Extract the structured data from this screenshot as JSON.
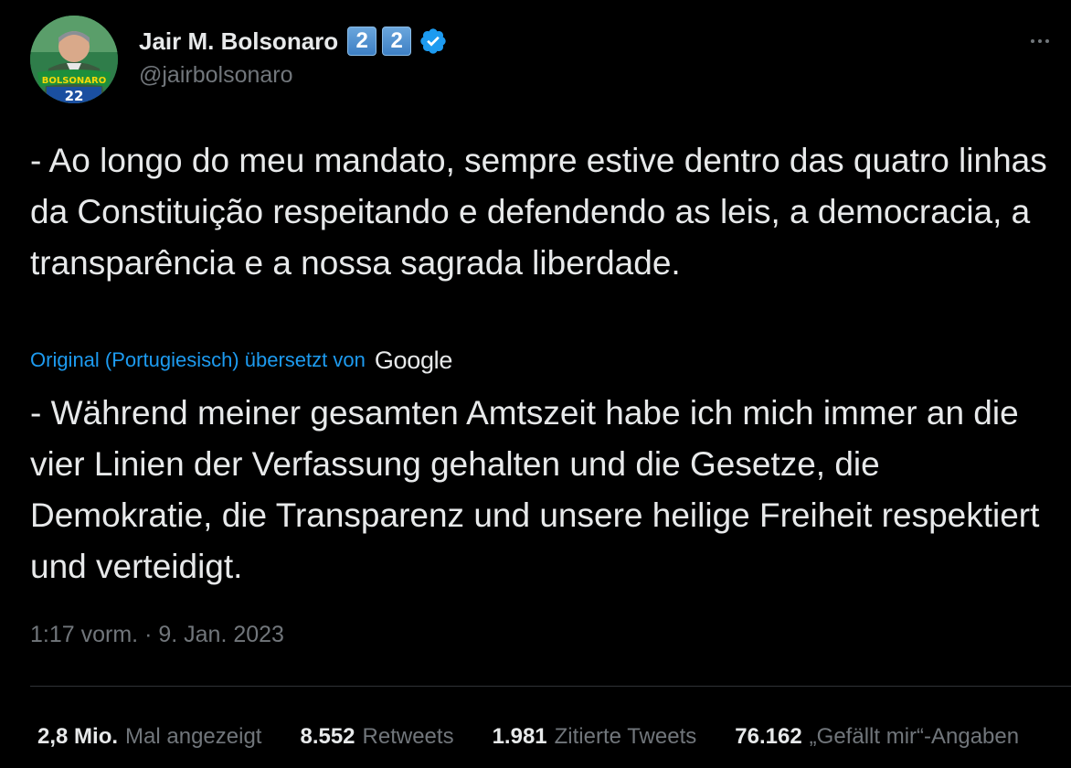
{
  "author": {
    "display_name": "Jair M. Bolsonaro",
    "badges": [
      "2",
      "2"
    ],
    "verified_icon": "verified-badge-icon",
    "handle": "@jairbolsonaro",
    "avatar_text": "BOLSONARO",
    "avatar_number": "22"
  },
  "tweet": {
    "original_text": "- Ao longo do meu mandato, sempre estive dentro das quatro linhas da Constituição respeitando e defendendo as leis, a democracia, a transparência e a nossa sagrada liberdade.",
    "translation_label": "Original (Portugiesisch) übersetzt von",
    "translation_provider": "Google",
    "translated_text": "- Während meiner gesamten Amtszeit habe ich mich immer an die vier Linien der Verfassung gehalten und die Gesetze, die Demokratie, die Transparenz und unsere heilige Freiheit respektiert und verteidigt.",
    "time": "1:17 vorm.",
    "separator": "·",
    "date": "9. Jan. 2023"
  },
  "stats": [
    {
      "value": "2,8 Mio.",
      "label": "Mal angezeigt"
    },
    {
      "value": "8.552",
      "label": "Retweets"
    },
    {
      "value": "1.981",
      "label": "Zitierte Tweets"
    },
    {
      "value": "76.162",
      "label": "„Gefällt mir“-Angaben"
    }
  ],
  "colors": {
    "background": "#000000",
    "text": "#e7e9ea",
    "secondary": "#71767b",
    "link": "#1d9bf0",
    "badge": "#3d7fc4"
  }
}
